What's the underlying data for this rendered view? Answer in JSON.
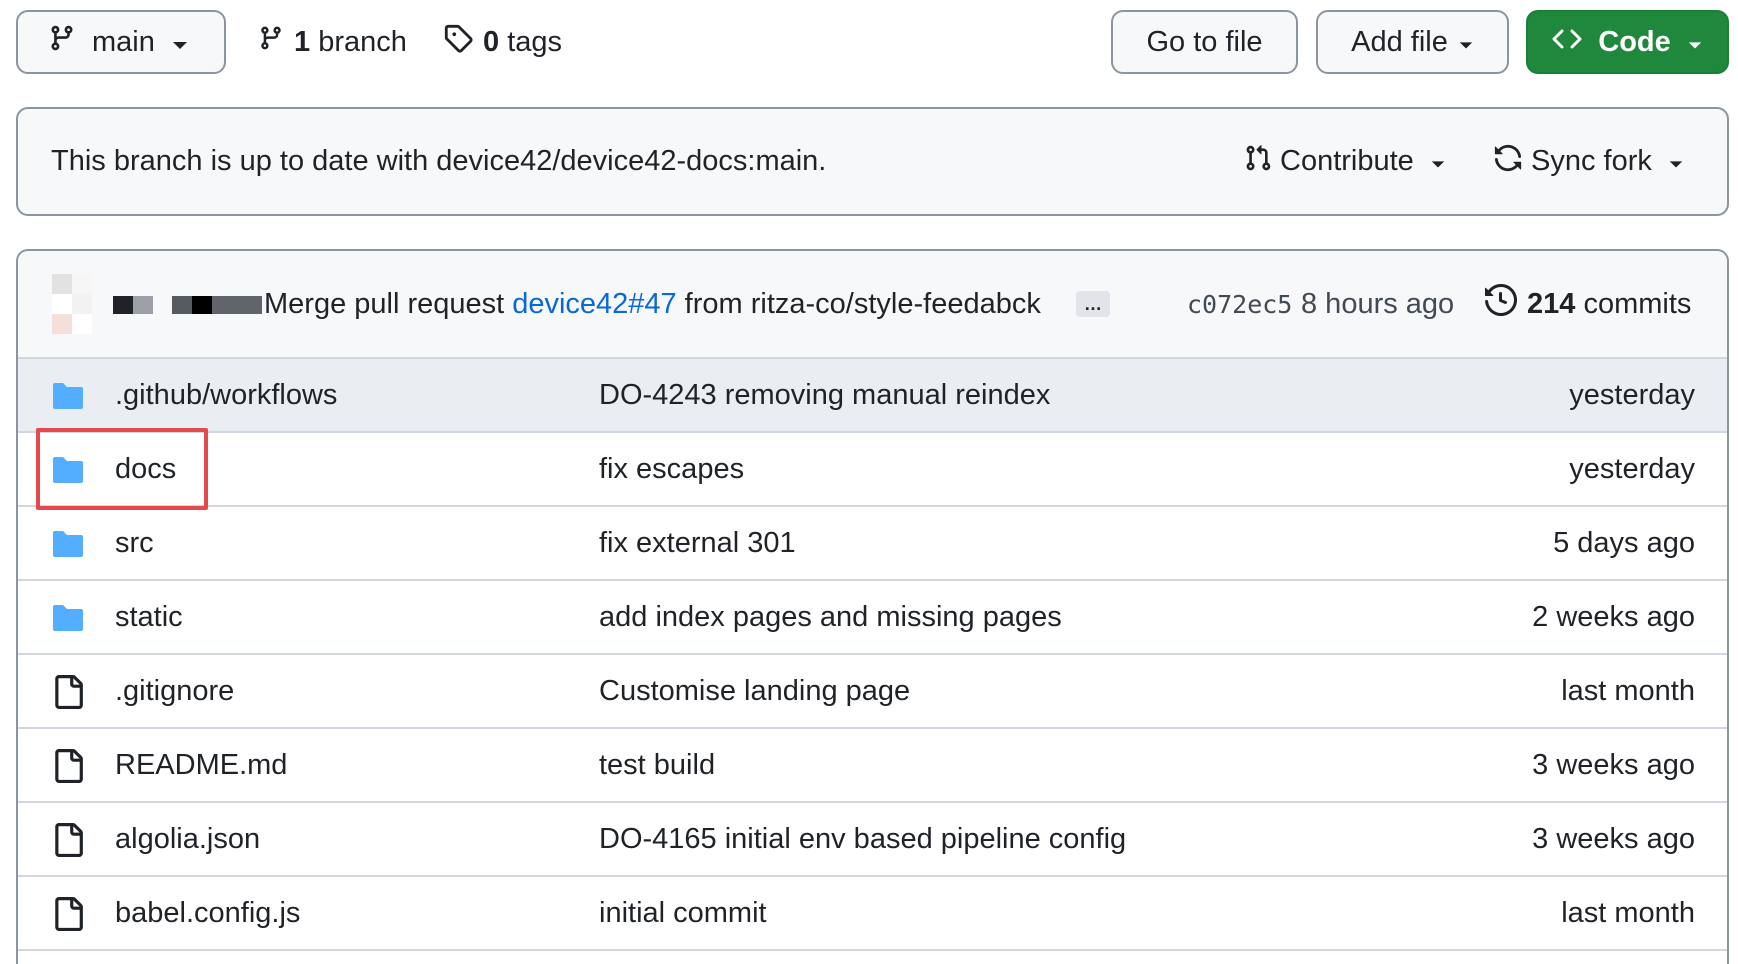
{
  "toolbar": {
    "branch_button_label": "main",
    "branches_count": "1",
    "branches_label": "branch",
    "tags_count": "0",
    "tags_label": "tags",
    "go_to_file_label": "Go to file",
    "add_file_label": "Add file",
    "code_label": "Code"
  },
  "banner": {
    "message": "This branch is up to date with device42/device42-docs:main.",
    "contribute_label": "Contribute",
    "sync_fork_label": "Sync fork"
  },
  "latest_commit": {
    "message_prefix": "Merge pull request",
    "pr_link": "device42#47",
    "message_suffix": "from ritza-co/style-feedabck",
    "ellipsis": "…",
    "sha": "c072ec5",
    "time": "8 hours ago",
    "commits_count": "214",
    "commits_label": "commits"
  },
  "files": [
    {
      "type": "folder",
      "name": ".github/workflows",
      "message": "DO-4243 removing manual reindex",
      "age": "yesterday"
    },
    {
      "type": "folder",
      "name": "docs",
      "message": "fix escapes",
      "age": "yesterday"
    },
    {
      "type": "folder",
      "name": "src",
      "message": "fix external 301",
      "age": "5 days ago"
    },
    {
      "type": "folder",
      "name": "static",
      "message": "add index pages and missing pages",
      "age": "2 weeks ago"
    },
    {
      "type": "file",
      "name": ".gitignore",
      "message": "Customise landing page",
      "age": "last month"
    },
    {
      "type": "file",
      "name": "README.md",
      "message": "test build",
      "age": "3 weeks ago"
    },
    {
      "type": "file",
      "name": "algolia.json",
      "message": "DO-4165 initial env based pipeline config",
      "age": "3 weeks ago"
    },
    {
      "type": "file",
      "name": "babel.config.js",
      "message": "initial commit",
      "age": "last month"
    }
  ],
  "icons": {
    "folder": "folder-icon",
    "file": "file-icon"
  },
  "colors": {
    "code_button": "#1f883d",
    "folder": "#54aeff",
    "link": "#0969da",
    "highlight_box": "#e5484d"
  }
}
